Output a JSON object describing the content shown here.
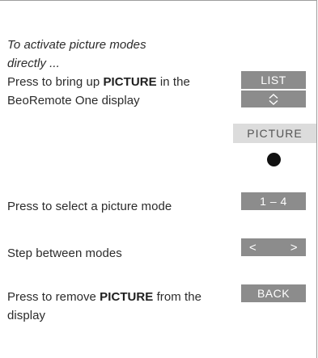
{
  "intro": {
    "line1": "To activate picture modes",
    "line2": "directly ..."
  },
  "step1": {
    "pre": "Press to bring up ",
    "bold": "PICTURE",
    "post": " in the BeoRemote One display"
  },
  "step2": {
    "text": "Press to select a picture mode"
  },
  "step3": {
    "text": "Step between modes"
  },
  "step4": {
    "pre": "Press to remove ",
    "bold": "PICTURE",
    "post": " from the display"
  },
  "keys": {
    "list": "LIST",
    "nav_icon": "up-down-chevron-icon",
    "display_label": "PICTURE",
    "center_button_icon": "filled-circle-icon",
    "number_range": "1 – 4",
    "left_arrow": "<",
    "right_arrow": ">",
    "back": "BACK"
  },
  "colors": {
    "key_bg": "#8c8c8c",
    "display_bg": "#dcdcdc",
    "text": "#2b2b2b"
  }
}
